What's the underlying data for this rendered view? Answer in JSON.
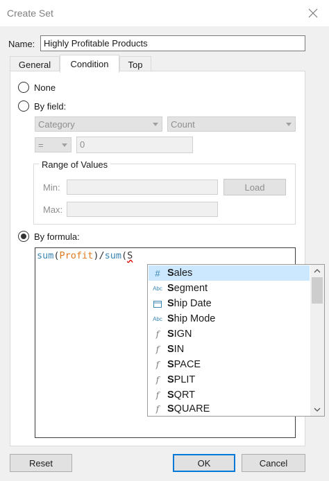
{
  "window": {
    "title": "Create Set"
  },
  "name": {
    "label": "Name:",
    "value": "Highly Profitable Products"
  },
  "tabs": [
    {
      "label": "General"
    },
    {
      "label": "Condition"
    },
    {
      "label": "Top"
    }
  ],
  "active_tab": "Condition",
  "condition": {
    "none_label": "None",
    "by_field_label": "By field:",
    "field_select": "Category",
    "aggregation_select": "Count",
    "operator_select": "=",
    "value_input": "0",
    "range_title": "Range of Values",
    "min_label": "Min:",
    "max_label": "Max:",
    "load_button": "Load",
    "by_formula_label": "By formula:",
    "selected_option": "By formula"
  },
  "formula": {
    "tokens": [
      {
        "text": "sum",
        "kind": "fn"
      },
      {
        "text": "(",
        "kind": "op"
      },
      {
        "text": "Profit",
        "kind": "field"
      },
      {
        "text": ")/",
        "kind": "op"
      },
      {
        "text": "sum",
        "kind": "fn"
      },
      {
        "text": "(",
        "kind": "op"
      },
      {
        "text": "S",
        "kind": "cursor"
      }
    ]
  },
  "autocomplete": {
    "typed_prefix": "S",
    "items": [
      {
        "icon": "number-field-icon",
        "glyph": "#",
        "bold": "S",
        "rest": "ales",
        "selected": true
      },
      {
        "icon": "string-field-icon",
        "glyph": "Abc",
        "bold": "S",
        "rest": "egment"
      },
      {
        "icon": "date-field-icon",
        "glyph": "▭",
        "bold": "S",
        "rest": "hip Date"
      },
      {
        "icon": "string-field-icon",
        "glyph": "Abc",
        "bold": "S",
        "rest": "hip Mode"
      },
      {
        "icon": "function-icon",
        "glyph": "f",
        "bold": "S",
        "rest": "IGN"
      },
      {
        "icon": "function-icon",
        "glyph": "f",
        "bold": "S",
        "rest": "IN"
      },
      {
        "icon": "function-icon",
        "glyph": "f",
        "bold": "S",
        "rest": "PACE"
      },
      {
        "icon": "function-icon",
        "glyph": "f",
        "bold": "S",
        "rest": "PLIT"
      },
      {
        "icon": "function-icon",
        "glyph": "f",
        "bold": "S",
        "rest": "QRT"
      },
      {
        "icon": "function-icon",
        "glyph": "f",
        "bold": "S",
        "rest": "QUARE"
      }
    ]
  },
  "buttons": {
    "reset": "Reset",
    "ok": "OK",
    "cancel": "Cancel"
  }
}
